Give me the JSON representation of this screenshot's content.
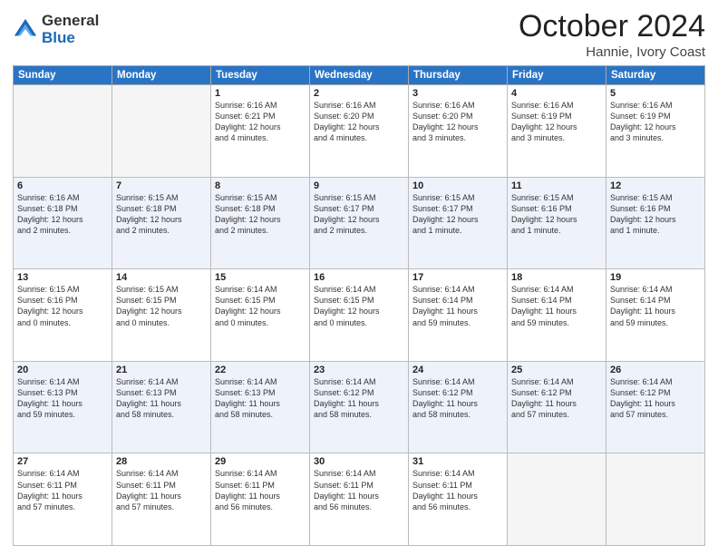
{
  "logo": {
    "general": "General",
    "blue": "Blue"
  },
  "title": "October 2024",
  "location": "Hannie, Ivory Coast",
  "days_of_week": [
    "Sunday",
    "Monday",
    "Tuesday",
    "Wednesday",
    "Thursday",
    "Friday",
    "Saturday"
  ],
  "weeks": [
    [
      {
        "day": null,
        "info": null
      },
      {
        "day": null,
        "info": null
      },
      {
        "day": "1",
        "info": "Sunrise: 6:16 AM\nSunset: 6:21 PM\nDaylight: 12 hours\nand 4 minutes."
      },
      {
        "day": "2",
        "info": "Sunrise: 6:16 AM\nSunset: 6:20 PM\nDaylight: 12 hours\nand 4 minutes."
      },
      {
        "day": "3",
        "info": "Sunrise: 6:16 AM\nSunset: 6:20 PM\nDaylight: 12 hours\nand 3 minutes."
      },
      {
        "day": "4",
        "info": "Sunrise: 6:16 AM\nSunset: 6:19 PM\nDaylight: 12 hours\nand 3 minutes."
      },
      {
        "day": "5",
        "info": "Sunrise: 6:16 AM\nSunset: 6:19 PM\nDaylight: 12 hours\nand 3 minutes."
      }
    ],
    [
      {
        "day": "6",
        "info": "Sunrise: 6:16 AM\nSunset: 6:18 PM\nDaylight: 12 hours\nand 2 minutes."
      },
      {
        "day": "7",
        "info": "Sunrise: 6:15 AM\nSunset: 6:18 PM\nDaylight: 12 hours\nand 2 minutes."
      },
      {
        "day": "8",
        "info": "Sunrise: 6:15 AM\nSunset: 6:18 PM\nDaylight: 12 hours\nand 2 minutes."
      },
      {
        "day": "9",
        "info": "Sunrise: 6:15 AM\nSunset: 6:17 PM\nDaylight: 12 hours\nand 2 minutes."
      },
      {
        "day": "10",
        "info": "Sunrise: 6:15 AM\nSunset: 6:17 PM\nDaylight: 12 hours\nand 1 minute."
      },
      {
        "day": "11",
        "info": "Sunrise: 6:15 AM\nSunset: 6:16 PM\nDaylight: 12 hours\nand 1 minute."
      },
      {
        "day": "12",
        "info": "Sunrise: 6:15 AM\nSunset: 6:16 PM\nDaylight: 12 hours\nand 1 minute."
      }
    ],
    [
      {
        "day": "13",
        "info": "Sunrise: 6:15 AM\nSunset: 6:16 PM\nDaylight: 12 hours\nand 0 minutes."
      },
      {
        "day": "14",
        "info": "Sunrise: 6:15 AM\nSunset: 6:15 PM\nDaylight: 12 hours\nand 0 minutes."
      },
      {
        "day": "15",
        "info": "Sunrise: 6:14 AM\nSunset: 6:15 PM\nDaylight: 12 hours\nand 0 minutes."
      },
      {
        "day": "16",
        "info": "Sunrise: 6:14 AM\nSunset: 6:15 PM\nDaylight: 12 hours\nand 0 minutes."
      },
      {
        "day": "17",
        "info": "Sunrise: 6:14 AM\nSunset: 6:14 PM\nDaylight: 11 hours\nand 59 minutes."
      },
      {
        "day": "18",
        "info": "Sunrise: 6:14 AM\nSunset: 6:14 PM\nDaylight: 11 hours\nand 59 minutes."
      },
      {
        "day": "19",
        "info": "Sunrise: 6:14 AM\nSunset: 6:14 PM\nDaylight: 11 hours\nand 59 minutes."
      }
    ],
    [
      {
        "day": "20",
        "info": "Sunrise: 6:14 AM\nSunset: 6:13 PM\nDaylight: 11 hours\nand 59 minutes."
      },
      {
        "day": "21",
        "info": "Sunrise: 6:14 AM\nSunset: 6:13 PM\nDaylight: 11 hours\nand 58 minutes."
      },
      {
        "day": "22",
        "info": "Sunrise: 6:14 AM\nSunset: 6:13 PM\nDaylight: 11 hours\nand 58 minutes."
      },
      {
        "day": "23",
        "info": "Sunrise: 6:14 AM\nSunset: 6:12 PM\nDaylight: 11 hours\nand 58 minutes."
      },
      {
        "day": "24",
        "info": "Sunrise: 6:14 AM\nSunset: 6:12 PM\nDaylight: 11 hours\nand 58 minutes."
      },
      {
        "day": "25",
        "info": "Sunrise: 6:14 AM\nSunset: 6:12 PM\nDaylight: 11 hours\nand 57 minutes."
      },
      {
        "day": "26",
        "info": "Sunrise: 6:14 AM\nSunset: 6:12 PM\nDaylight: 11 hours\nand 57 minutes."
      }
    ],
    [
      {
        "day": "27",
        "info": "Sunrise: 6:14 AM\nSunset: 6:11 PM\nDaylight: 11 hours\nand 57 minutes."
      },
      {
        "day": "28",
        "info": "Sunrise: 6:14 AM\nSunset: 6:11 PM\nDaylight: 11 hours\nand 57 minutes."
      },
      {
        "day": "29",
        "info": "Sunrise: 6:14 AM\nSunset: 6:11 PM\nDaylight: 11 hours\nand 56 minutes."
      },
      {
        "day": "30",
        "info": "Sunrise: 6:14 AM\nSunset: 6:11 PM\nDaylight: 11 hours\nand 56 minutes."
      },
      {
        "day": "31",
        "info": "Sunrise: 6:14 AM\nSunset: 6:11 PM\nDaylight: 11 hours\nand 56 minutes."
      },
      {
        "day": null,
        "info": null
      },
      {
        "day": null,
        "info": null
      }
    ]
  ]
}
